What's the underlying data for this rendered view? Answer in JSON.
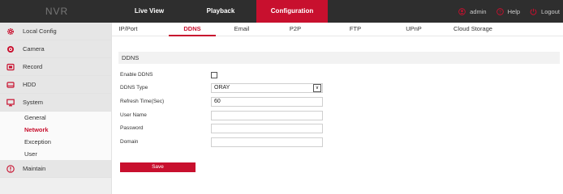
{
  "app": {
    "brand": "NVR"
  },
  "topnav": {
    "items": [
      {
        "label": "Live View"
      },
      {
        "label": "Playback"
      },
      {
        "label": "Configuration"
      }
    ],
    "active_color": "#c8102e"
  },
  "user_area": {
    "admin": "admin",
    "help": "Help",
    "logout": "Logout"
  },
  "sidebar": {
    "items": [
      {
        "label": "Local Config",
        "icon": "gear-icon"
      },
      {
        "label": "Camera",
        "icon": "camera-icon"
      },
      {
        "label": "Record",
        "icon": "record-icon"
      },
      {
        "label": "HDD",
        "icon": "hdd-icon"
      },
      {
        "label": "System",
        "icon": "monitor-icon"
      },
      {
        "label": "Maintain",
        "icon": "info-icon"
      }
    ],
    "system_sub": [
      "General",
      "Network",
      "Exception",
      "User"
    ],
    "active_sub": "Network"
  },
  "subtabs": [
    "IP/Port",
    "DDNS",
    "Email",
    "P2P",
    "FTP",
    "UPnP",
    "Cloud Storage"
  ],
  "active_subtab": "DDNS",
  "panel": {
    "title": "DDNS",
    "fields": {
      "enable_ddns": {
        "label": "Enable DDNS",
        "checked": false
      },
      "ddns_type": {
        "label": "DDNS Type",
        "value": "ORAY"
      },
      "refresh_time": {
        "label": "Refresh Time(Sec)",
        "value": "60"
      },
      "user_name": {
        "label": "User Name",
        "value": ""
      },
      "password": {
        "label": "Password",
        "value": ""
      },
      "domain": {
        "label": "Domain",
        "value": ""
      }
    },
    "save_label": "Save"
  }
}
